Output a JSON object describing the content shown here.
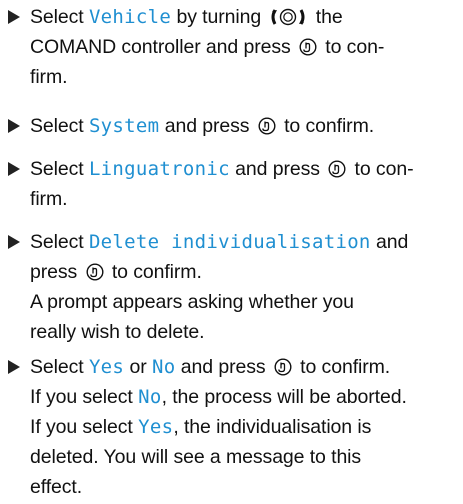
{
  "steps": [
    {
      "a_select": "Select",
      "a_option": "Vehicle",
      "a_by": "by turning",
      "a_the": "the",
      "b_text": "COMAND controller and press",
      "b_confirm": "to con-",
      "c_text": "firm.",
      "icon": "turn-controller-icon"
    },
    {
      "select": "Select",
      "option": "System",
      "press": "and press",
      "confirm": "to confirm."
    },
    {
      "a_select": "Select",
      "a_option": "Linguatronic",
      "a_press": "and press",
      "a_confirm": "to con-",
      "b_text": "firm."
    },
    {
      "a_select": "Select",
      "a_option": "Delete individualisation",
      "a_and": "and",
      "b_press": "press",
      "b_confirm": "to confirm.",
      "c_text": "A prompt appears asking whether you",
      "d_text": "really wish to delete."
    },
    {
      "a_select": "Select",
      "a_yes": "Yes",
      "a_or": "or",
      "a_no": "No",
      "a_press": "and press",
      "a_confirm": "to confirm.",
      "b_if": "If you select",
      "b_no": "No",
      "b_rest": ", the process will be aborted.",
      "c_if": "If you select",
      "c_yes": "Yes",
      "c_rest": ", the individualisation is",
      "d_text": "deleted. You will see a message to this",
      "e_text": "effect."
    }
  ],
  "colors": {
    "option_text": "#1f8fd1",
    "body_text": "#111111"
  },
  "icons": {
    "confirm": "press-controller-icon",
    "turn": "turn-controller-icon",
    "bullet": "bullet-arrow-icon"
  }
}
